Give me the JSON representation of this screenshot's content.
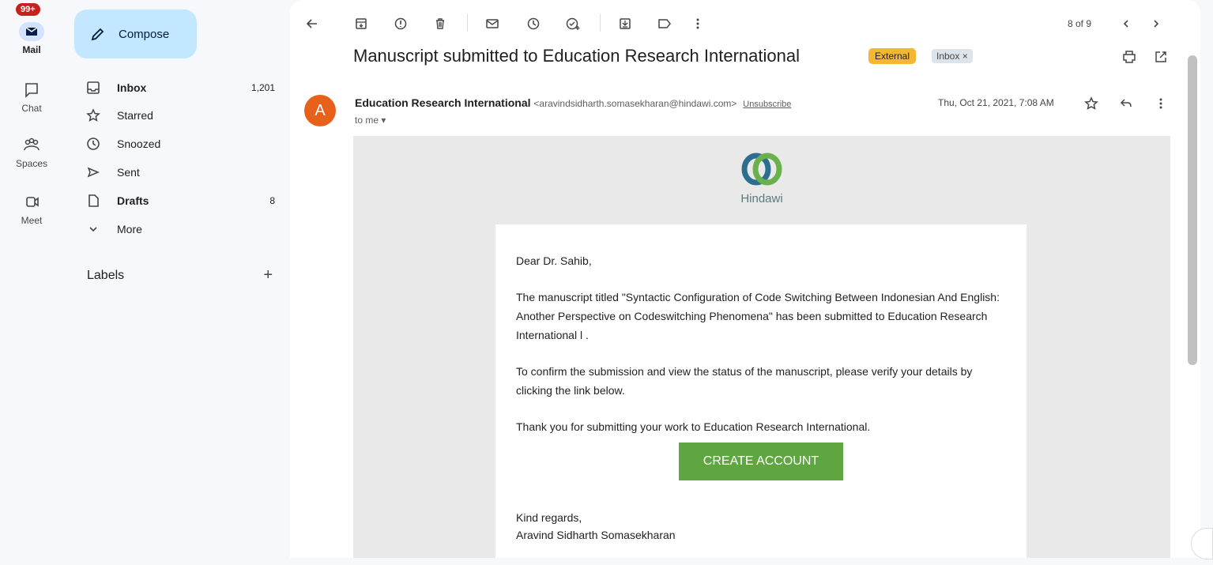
{
  "rail": {
    "badge": "99+",
    "items": [
      {
        "label": "Mail",
        "icon": "mail-icon"
      },
      {
        "label": "Chat",
        "icon": "chat-icon"
      },
      {
        "label": "Spaces",
        "icon": "spaces-icon"
      },
      {
        "label": "Meet",
        "icon": "meet-icon"
      }
    ]
  },
  "sidebar": {
    "compose_label": "Compose",
    "items": [
      {
        "label": "Inbox",
        "count": "1,201",
        "icon": "inbox-icon"
      },
      {
        "label": "Starred",
        "count": "",
        "icon": "star-icon"
      },
      {
        "label": "Snoozed",
        "count": "",
        "icon": "clock-icon"
      },
      {
        "label": "Sent",
        "count": "",
        "icon": "send-icon"
      },
      {
        "label": "Drafts",
        "count": "8",
        "icon": "draft-icon"
      },
      {
        "label": "More",
        "count": "",
        "icon": "chevron-down-icon"
      }
    ],
    "labels_title": "Labels",
    "labels_add": "+"
  },
  "toolbar": {
    "pager": "8 of 9"
  },
  "message": {
    "subject": "Manuscript submitted to Education Research International",
    "tag_external": "External",
    "tag_inbox": "Inbox ×",
    "avatar_letter": "A",
    "sender_name": "Education Research International",
    "sender_email": "<aravindsidharth.somasekharan@hindawi.com>",
    "unsubscribe": "Unsubscribe",
    "to": "to me ▾",
    "date": "Thu, Oct 21, 2021, 7:08 AM"
  },
  "body": {
    "logo_text": "Hindawi",
    "greeting": "Dear Dr. Sahib,",
    "para1": "The manuscript titled \"Syntactic Configuration of Code Switching Between Indonesian And English: Another Perspective on Codeswitching Phenomena\" has been submitted to Education Research International l .",
    "para2": "To confirm the submission and view the status of the manuscript, please verify your details by clicking the link below.",
    "para3": "Thank you for submitting your work to Education Research International.",
    "cta": "CREATE ACCOUNT",
    "regards": "Kind regards,",
    "signer": "Aravind Sidharth Somasekharan"
  },
  "colors": {
    "compose_bg": "#c2e7ff",
    "avatar": "#e8611a",
    "external_tag": "#f5b731",
    "cta": "#5fa642"
  }
}
